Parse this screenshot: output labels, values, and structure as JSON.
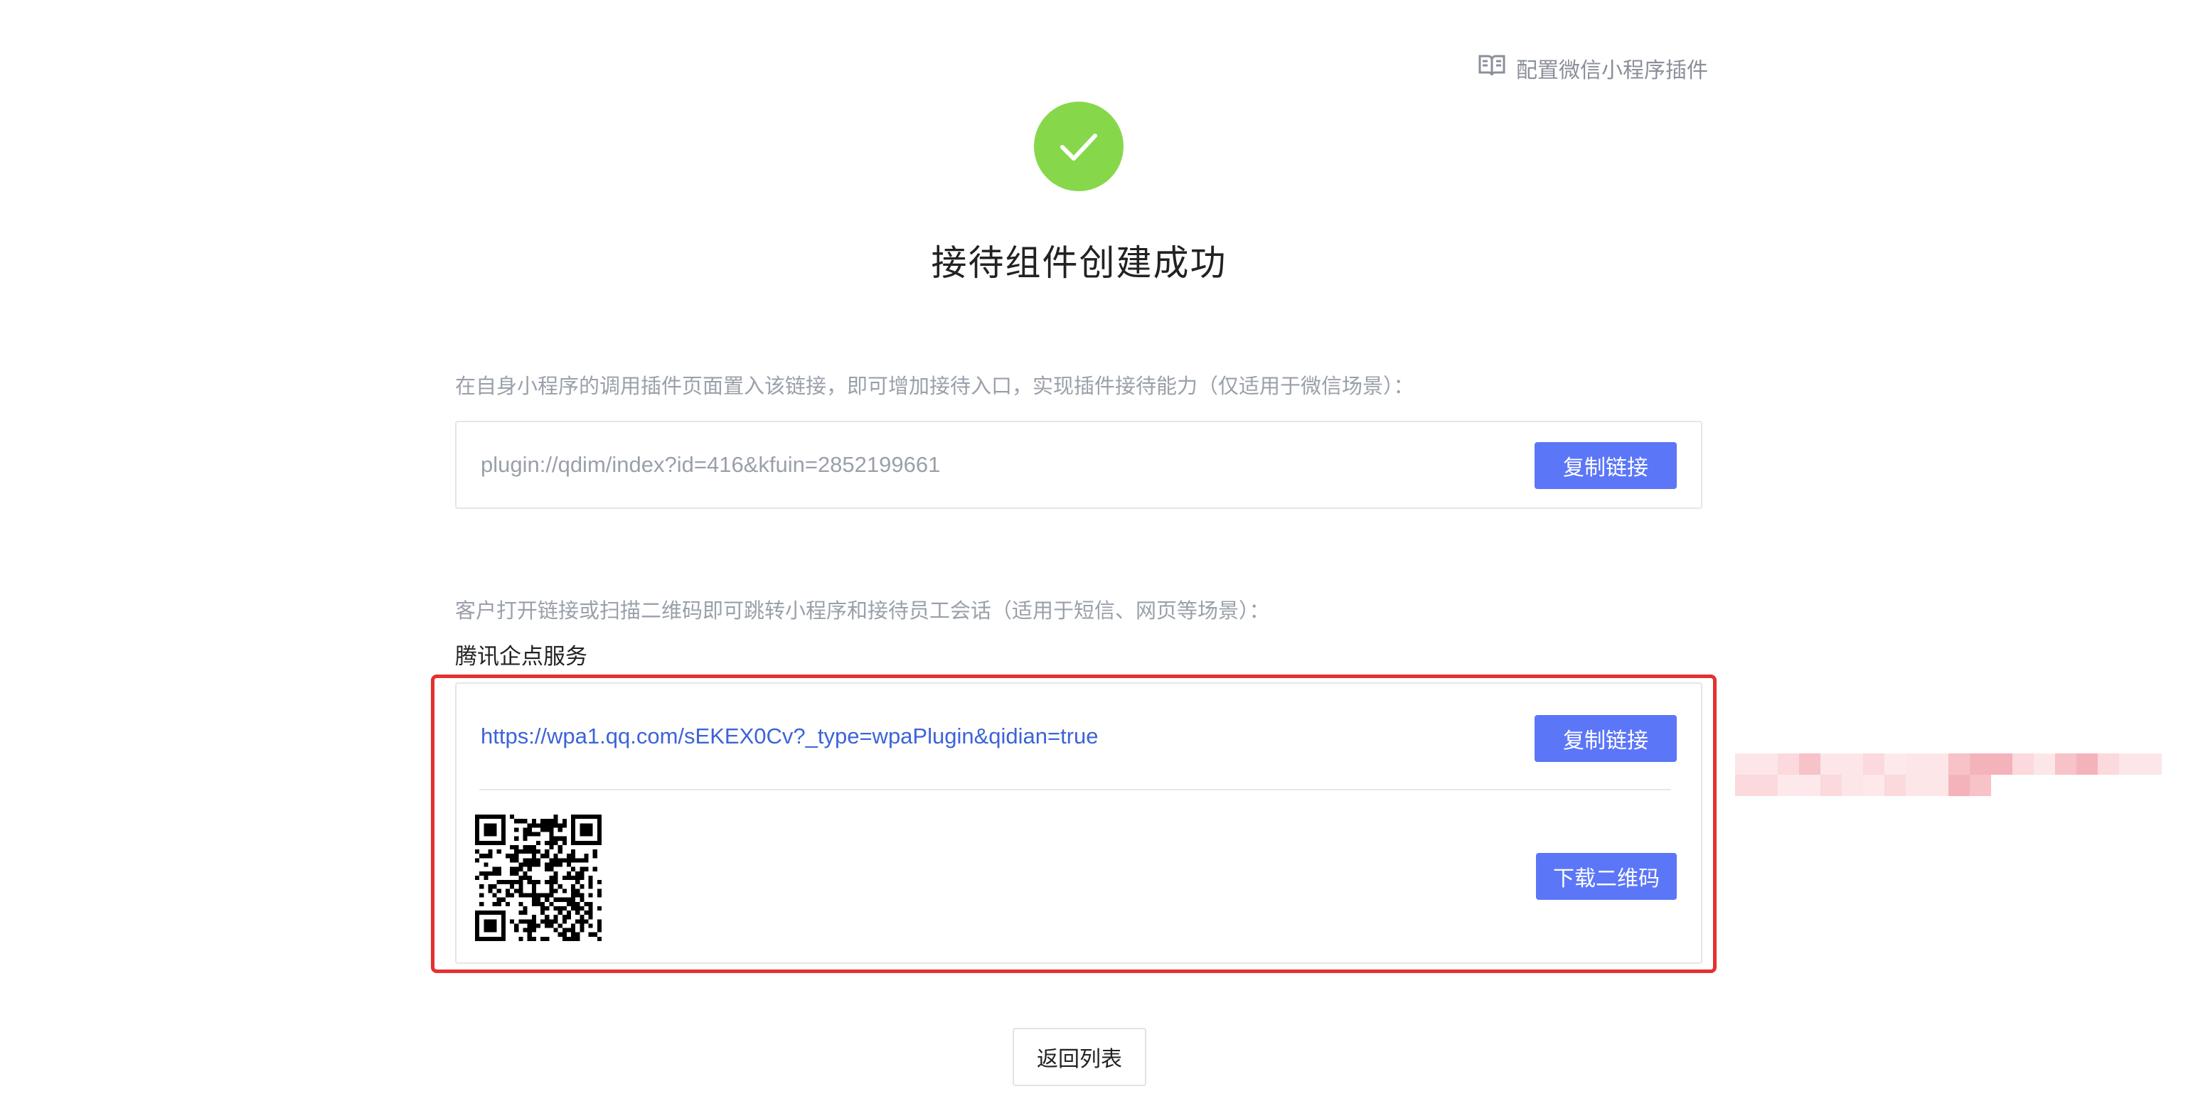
{
  "header": {
    "help_link_label": "配置微信小程序插件",
    "help_icon": "book-icon"
  },
  "success": {
    "icon": "check-circle-icon",
    "icon_color": "#86d84a",
    "title": "接待组件创建成功"
  },
  "plugin_section": {
    "description": "在自身小程序的调用插件页面置入该链接，即可增加接待入口，实现插件接待能力（仅适用于微信场景）：",
    "link": "plugin://qdim/index?id=416&kfuin=2852199661",
    "copy_label": "复制链接"
  },
  "wpa_section": {
    "description": "客户打开链接或扫描二维码即可跳转小程序和接待员工会话（适用于短信、网页等场景）：",
    "sub_label": "腾讯企点服务",
    "link": "https://wpa1.qq.com/sEKEX0Cv?_type=wpaPlugin&qidian=true",
    "copy_label": "复制链接",
    "download_label": "下载二维码",
    "highlight_color": "#e53030"
  },
  "footer": {
    "back_label": "返回列表"
  },
  "colors": {
    "primary": "#5b76f7",
    "link": "#3d63d9",
    "muted_text": "#9aa0aa"
  }
}
